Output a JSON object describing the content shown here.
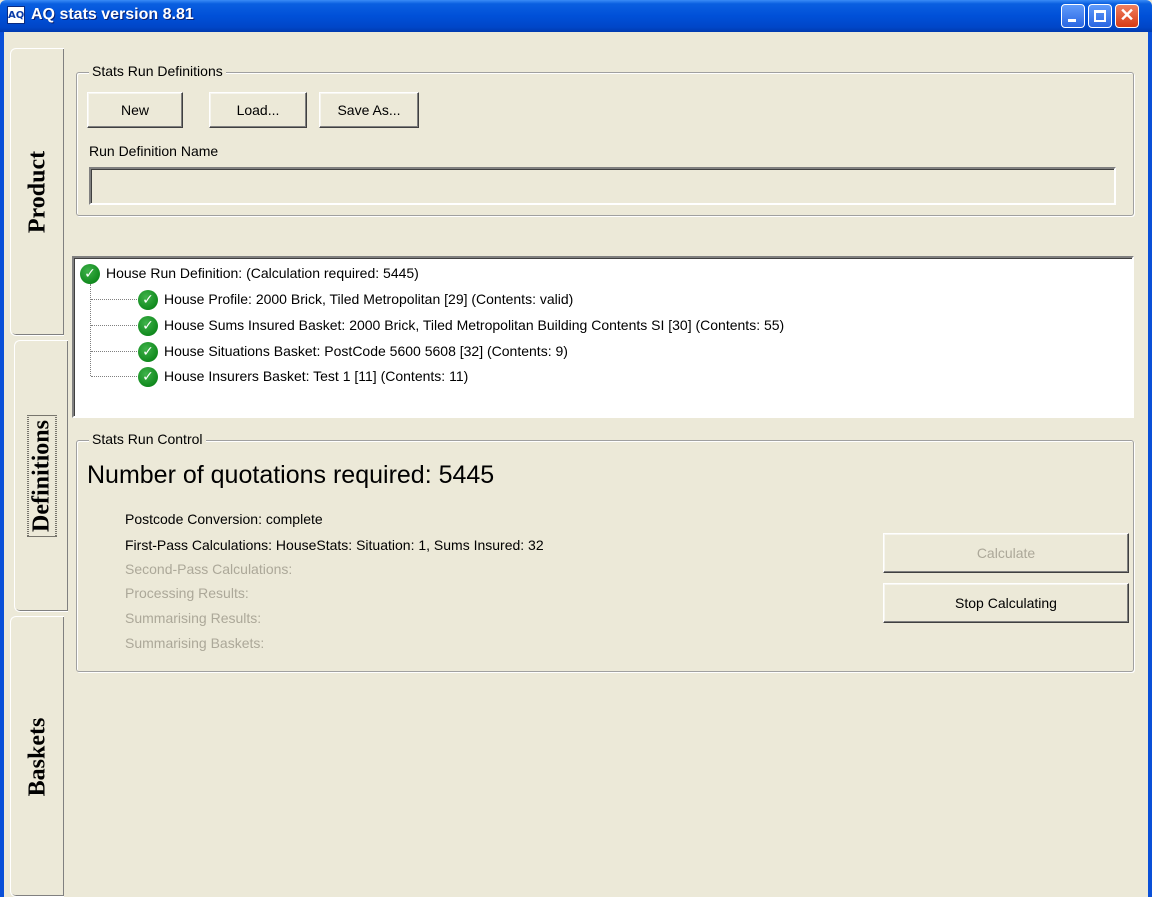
{
  "window": {
    "title": "AQ stats version 8.81",
    "icon_label": "AQ",
    "close_glyph": "✕"
  },
  "tabs": [
    {
      "label": "Product",
      "selected": false
    },
    {
      "label": "Definitions",
      "selected": true
    },
    {
      "label": "Baskets",
      "selected": false
    }
  ],
  "run_definitions": {
    "group_title": "Stats Run Definitions",
    "buttons": {
      "new": "New",
      "load": "Load...",
      "save_as": "Save As..."
    },
    "name_label": "Run Definition Name",
    "name_value": ""
  },
  "tree": {
    "root": "House Run Definition:  (Calculation required: 5445)",
    "children": [
      "House Profile: 2000 Brick, Tiled Metropolitan [29] (Contents: valid)",
      "House Sums Insured Basket: 2000 Brick, Tiled Metropolitan Building  Contents SI [30] (Contents: 55)",
      "House Situations Basket: PostCode 5600 5608 [32] (Contents: 9)",
      "House Insurers Basket: Test 1 [11] (Contents: 11)"
    ],
    "check_glyph": "✓"
  },
  "run_control": {
    "group_title": "Stats Run Control",
    "headline": "Number of quotations required: 5445",
    "statuses": [
      {
        "text": "Postcode Conversion: complete",
        "enabled": true
      },
      {
        "text": "First-Pass Calculations: HouseStats: Situation: 1, Sums Insured: 32",
        "enabled": true
      },
      {
        "text": "Second-Pass Calculations:",
        "enabled": false
      },
      {
        "text": "Processing Results:",
        "enabled": false
      },
      {
        "text": "Summarising Results:",
        "enabled": false
      },
      {
        "text": "Summarising Baskets:",
        "enabled": false
      }
    ],
    "buttons": {
      "calculate": "Calculate",
      "stop": "Stop Calculating"
    }
  },
  "colors": {
    "title_bar": "#0050d8",
    "window_bg": "#ece9d8",
    "check_green": "#118a1e",
    "disabled_text": "#aca899"
  }
}
